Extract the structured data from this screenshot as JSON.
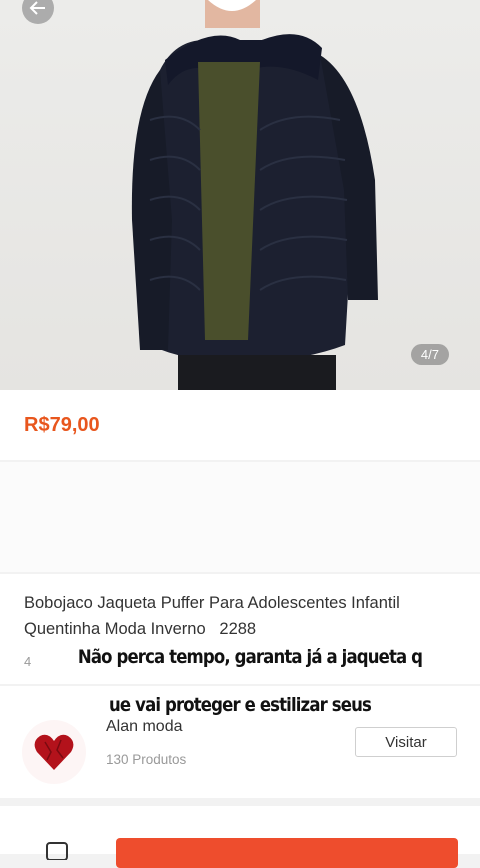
{
  "product": {
    "image_counter": "4/7",
    "price": "R$79,00",
    "title": "Bobojaco Jaqueta Puffer Para Adolescentes Infantil Quentinha Moda Inverno",
    "sold_count": "2288",
    "sold_prefix": "4"
  },
  "overlay_caption": {
    "line1": "Não perca tempo, garanta já a jaqueta q",
    "line2": "ue vai proteger e estilizar seus"
  },
  "shop": {
    "name": "Alan moda",
    "products": "130 Produtos",
    "visit_label": "Visitar"
  },
  "colors": {
    "accent": "#ee4d2d",
    "price": "#e8561d"
  },
  "icons": [
    "back-arrow-icon",
    "heart-logo-icon",
    "chat-icon"
  ]
}
